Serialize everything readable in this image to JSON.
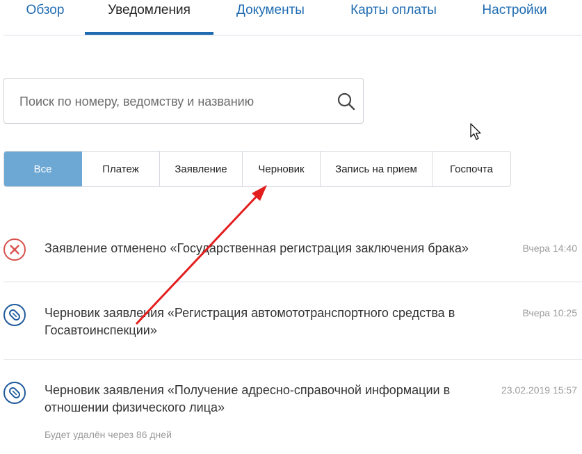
{
  "tabs": [
    {
      "label": "Обзор"
    },
    {
      "label": "Уведомления"
    },
    {
      "label": "Документы"
    },
    {
      "label": "Карты оплаты"
    },
    {
      "label": "Настройки"
    }
  ],
  "active_tab": "Уведомления",
  "search": {
    "placeholder": "Поиск по номеру, ведомству и названию",
    "value": ""
  },
  "filters": [
    {
      "label": "Все"
    },
    {
      "label": "Платеж"
    },
    {
      "label": "Заявление"
    },
    {
      "label": "Черновик"
    },
    {
      "label": "Запись на прием"
    },
    {
      "label": "Госпочта"
    }
  ],
  "active_filter": "Все",
  "notifications": [
    {
      "icon": "cancel-icon",
      "title": "Заявление отменено «Государственная регистрация заключения брака»",
      "time": "Вчера 14:40"
    },
    {
      "icon": "draft-clip-icon",
      "title": "Черновик заявления «Регистрация автомототранспортного средства в Госавтоинспекции»",
      "time": "Вчера 10:25"
    },
    {
      "icon": "draft-clip-icon",
      "title": "Черновик заявления «Получение адресно-справочной информации в отношении физического лица»",
      "time": "23.02.2019 15:57",
      "note": "Будет удалён через 86 дней"
    }
  ],
  "colors": {
    "link": "#1e6bb1",
    "active_filter_bg": "#6da8d4",
    "cancel_icon": "#d9534f",
    "draft_icon": "#1e5a9c",
    "annotation_arrow": "#e31e1e"
  }
}
